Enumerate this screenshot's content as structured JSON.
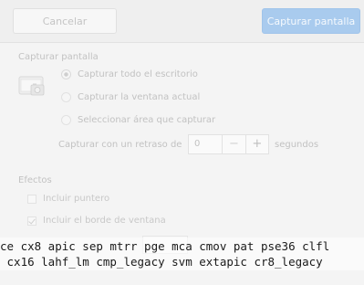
{
  "header": {
    "cancel_label": "Cancelar",
    "capture_label": "Capturar pantalla"
  },
  "capture_section": {
    "title": "Capturar pantalla",
    "options": [
      {
        "label": "Capturar todo el escritorio",
        "selected": true
      },
      {
        "label": "Capturar la ventana actual",
        "selected": false
      },
      {
        "label": "Seleccionar área que capturar",
        "selected": false
      }
    ],
    "delay_label": "Capturar con un retraso de",
    "delay_value": "0",
    "delay_decrement": "−",
    "delay_increment": "+",
    "seconds_label": "segundos"
  },
  "effects_section": {
    "title": "Efectos",
    "options": [
      {
        "label": "Incluir puntero",
        "checked": false
      },
      {
        "label": "Incluir el borde de ventana",
        "checked": true
      }
    ]
  },
  "terminal_overlay": {
    "line1": "ce cx8 apic sep mtrr pge mca cmov pat pse36 clfl",
    "line2": " cx16 lahf_lm cmp_legacy svm extapic cr8_legacy"
  },
  "colors": {
    "primary_button": "#a9cbee",
    "dimmed_text": "#c2c2c2",
    "terminal_text": "#1a1a1a"
  }
}
